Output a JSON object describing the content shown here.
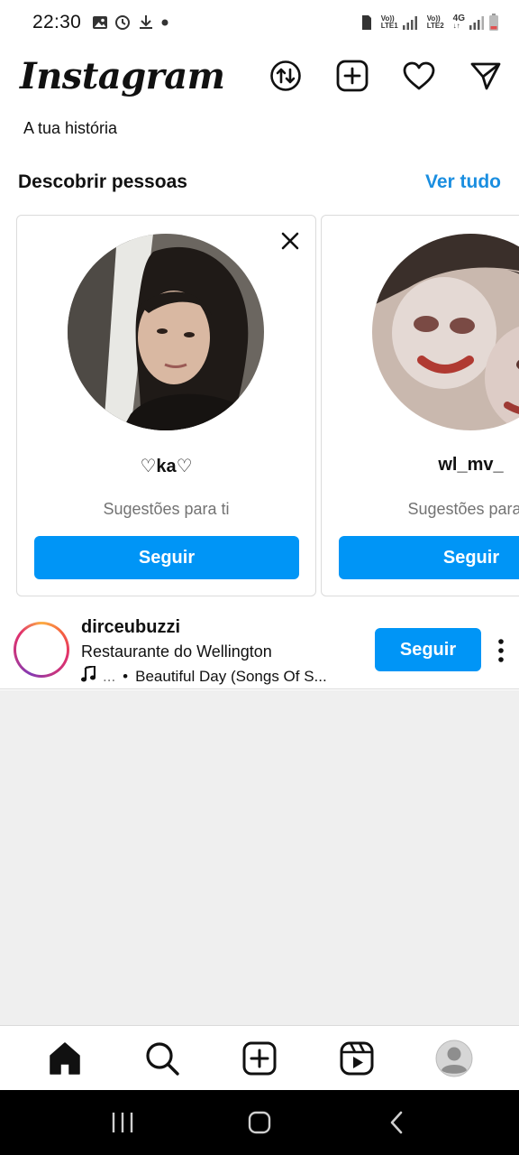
{
  "status_bar": {
    "time": "22:30",
    "net1": [
      "Vo))",
      "LTE1"
    ],
    "net2": [
      "Vo))",
      "LTE2"
    ],
    "net_type": "4G",
    "icons": [
      "gallery-icon",
      "alarm-icon",
      "download-icon",
      "dot-icon",
      "sim-icon",
      "signal-icon",
      "battery-icon"
    ]
  },
  "header": {
    "logo": "Instagram",
    "actions": [
      "sync-icon",
      "new-post-icon",
      "heart-icon",
      "send-icon"
    ]
  },
  "story": {
    "label": "A tua história"
  },
  "discover": {
    "title": "Descobrir pessoas",
    "see_all": "Ver tudo",
    "cards": [
      {
        "name": "♡ka♡",
        "subtitle": "Sugestões para ti",
        "follow_label": "Seguir"
      },
      {
        "name": "wl_mv_",
        "subtitle": "Sugestões para ti",
        "follow_label": "Seguir"
      }
    ]
  },
  "post": {
    "username": "dirceubuzzi",
    "location": "Restaurante do Wellington",
    "music_prefix": "...",
    "music": "Beautiful Day (Songs Of S...",
    "follow_label": "Seguir"
  },
  "colors": {
    "accent": "#0095f6",
    "link": "#1a8ee0",
    "muted": "#737373",
    "feed_bg": "#efefef"
  },
  "bottom_nav": [
    "home-icon",
    "search-icon",
    "create-icon",
    "reels-icon",
    "profile-icon"
  ],
  "system_nav": [
    "recents-icon",
    "home-button-icon",
    "back-icon"
  ]
}
